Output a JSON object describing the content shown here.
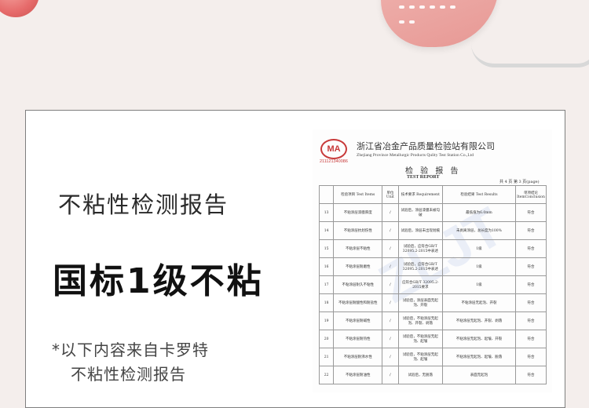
{
  "texts": {
    "title": "不粘性检测报告",
    "headline": "国标1级不粘",
    "note_line1": "*以下内容来自卡罗特",
    "note_line2": "不粘性检测报告"
  },
  "report": {
    "org_cn": "浙江省冶金产品质量检验站有限公司",
    "org_en": "Zhejiang Province Metallurgic Products Qulity Test Station Co.,Ltd",
    "logo_text": "MA",
    "logo_code": "211121340086",
    "title_cn": "检 验 报 告",
    "title_en": "TEST REPORT",
    "page_info": "共 4 页 第 3 页(page)",
    "columns": [
      "检验项目\nTest Items",
      "单位\nUnit",
      "技术要求\nRequirement",
      "检验结果\nTest Results",
      "单项结论\nItemConclusion"
    ],
    "rows": [
      {
        "no": "13",
        "item": "不粘涂层漆膜厚度",
        "unit": "/",
        "req": "试验后，涂层漆膜未被勾破",
        "result": "最低值为6.0mm",
        "concl": "符合"
      },
      {
        "no": "14",
        "item": "不粘涂层抗划伤性",
        "unit": "/",
        "req": "试验后，涂层未出现划痕",
        "result": "未剥离涂层，总长度为100%",
        "concl": "符合"
      },
      {
        "no": "15",
        "item": "不粘涂层不粘性",
        "unit": "/",
        "req": "试验后，应符合GB/T 32095.2-2015中表述",
        "result": "1级",
        "concl": "符合"
      },
      {
        "no": "16",
        "item": "不粘涂层耐磨性",
        "unit": "/",
        "req": "试验后，应符合GB/T 32095.2-2015中表述",
        "result": "1级",
        "concl": "符合"
      },
      {
        "no": "17",
        "item": "不粘涂层耐久不粘性",
        "unit": "/",
        "req": "应符合GB/T 32095.2-2015要求",
        "result": "1级",
        "concl": "符合"
      },
      {
        "no": "18",
        "item": "不粘涂层耐酸性和耐盐性",
        "unit": "/",
        "req": "试验后，涂层表面无起泡、开裂",
        "result": "不粘涂层无起泡、开裂",
        "concl": "符合"
      },
      {
        "no": "19",
        "item": "不粘涂层耐碱性",
        "unit": "/",
        "req": "试验后，不粘涂层无起泡、开裂、剥落",
        "result": "不粘涂层无起泡、开裂、剥落",
        "concl": "符合"
      },
      {
        "no": "20",
        "item": "不粘涂层耐热性",
        "unit": "/",
        "req": "试验后，不粘涂层无起泡、起皱",
        "result": "不粘涂层无起泡、起皱、开裂",
        "concl": "符合"
      },
      {
        "no": "21",
        "item": "不粘涂层耐沸水性",
        "unit": "/",
        "req": "试验后，不粘涂层无起泡、起皱",
        "result": "不粘涂层无起泡、起皱、脱落",
        "concl": "符合"
      },
      {
        "no": "22",
        "item": "不粘涂层耐油性",
        "unit": "/",
        "req": "试验后，无脱落",
        "result": "表面无起泡",
        "concl": "符合"
      }
    ]
  },
  "colors": {
    "background": "#f4eeec",
    "logo_red": "#c83a3a",
    "pan_pink": "#e79894"
  }
}
